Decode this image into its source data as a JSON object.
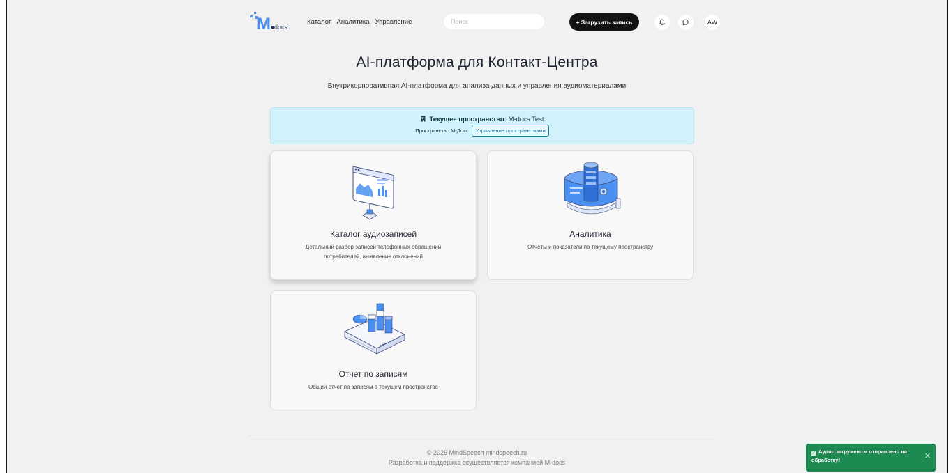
{
  "header": {
    "logo_text": "M docs",
    "nav": [
      "Каталог",
      "Аналитика",
      "Управление"
    ],
    "search_placeholder": "Поиск",
    "upload_label": "+ Загрузить запись",
    "avatar_initials": "AW"
  },
  "hero": {
    "title": "AI-платформа для Контакт-Центра",
    "subtitle": "Внутрикорпоративная AI-платформа для анализа данных и управления аудиоматериалами"
  },
  "space": {
    "label": "Текущее пространство:",
    "name": "M-docs Test",
    "org": "Пространство М-Докс",
    "manage_label": "Управление пространствами"
  },
  "cards": [
    {
      "title": "Каталог аудиозаписей",
      "desc_line1": "Детальный разбор записей телефонных обращений",
      "desc_line2": "потребителей, выявление отклонений"
    },
    {
      "title": "Аналитика",
      "desc_line1": "Отчёты и показатели по текущему пространству",
      "desc_line2": ""
    },
    {
      "title": "Отчет по записям",
      "desc_line1": "Общий отчет по записям в текущем пространстве",
      "desc_line2": ""
    }
  ],
  "footer": {
    "copyright": "© 2026 MindSpeech mindspeech.ru",
    "support": "Разработка и поддержка осуществляется компанией M-docs"
  },
  "toast": {
    "line1": "Аудио загружено и отправлено на",
    "line2": "обработку!"
  },
  "colors": {
    "accent": "#4a90f0",
    "banner": "#d1f2fa",
    "toast": "#1d8a52"
  }
}
